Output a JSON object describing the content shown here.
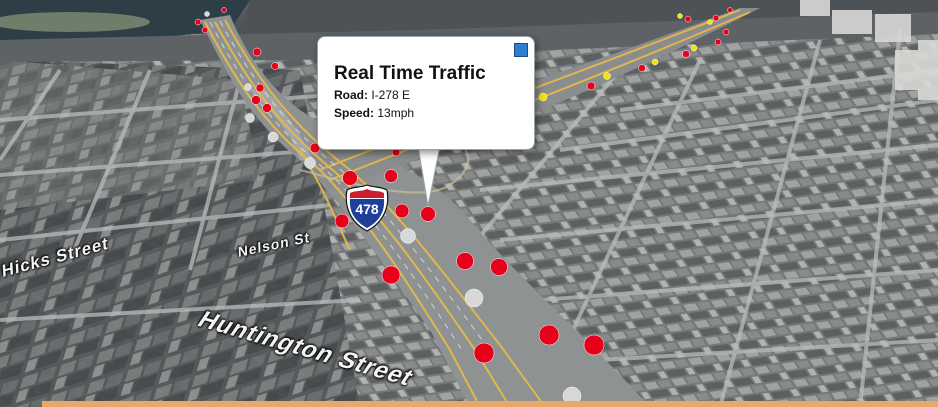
{
  "popup": {
    "title": "Real Time Traffic",
    "road_label": "Road:",
    "road_value": "I-278 E",
    "speed_label": "Speed:",
    "speed_value": "13mph"
  },
  "streets": {
    "huntington": "Huntington Street",
    "hicks": "Hicks Street",
    "nelson": "Nelson St"
  },
  "highway_shield": {
    "number": "478",
    "color": "#1f3f9a"
  },
  "traffic_colors": {
    "slow": "#e8001a",
    "moderate": "#f2e600",
    "no_data": "#d8d8d8",
    "highway_line": "#e6b84a"
  }
}
